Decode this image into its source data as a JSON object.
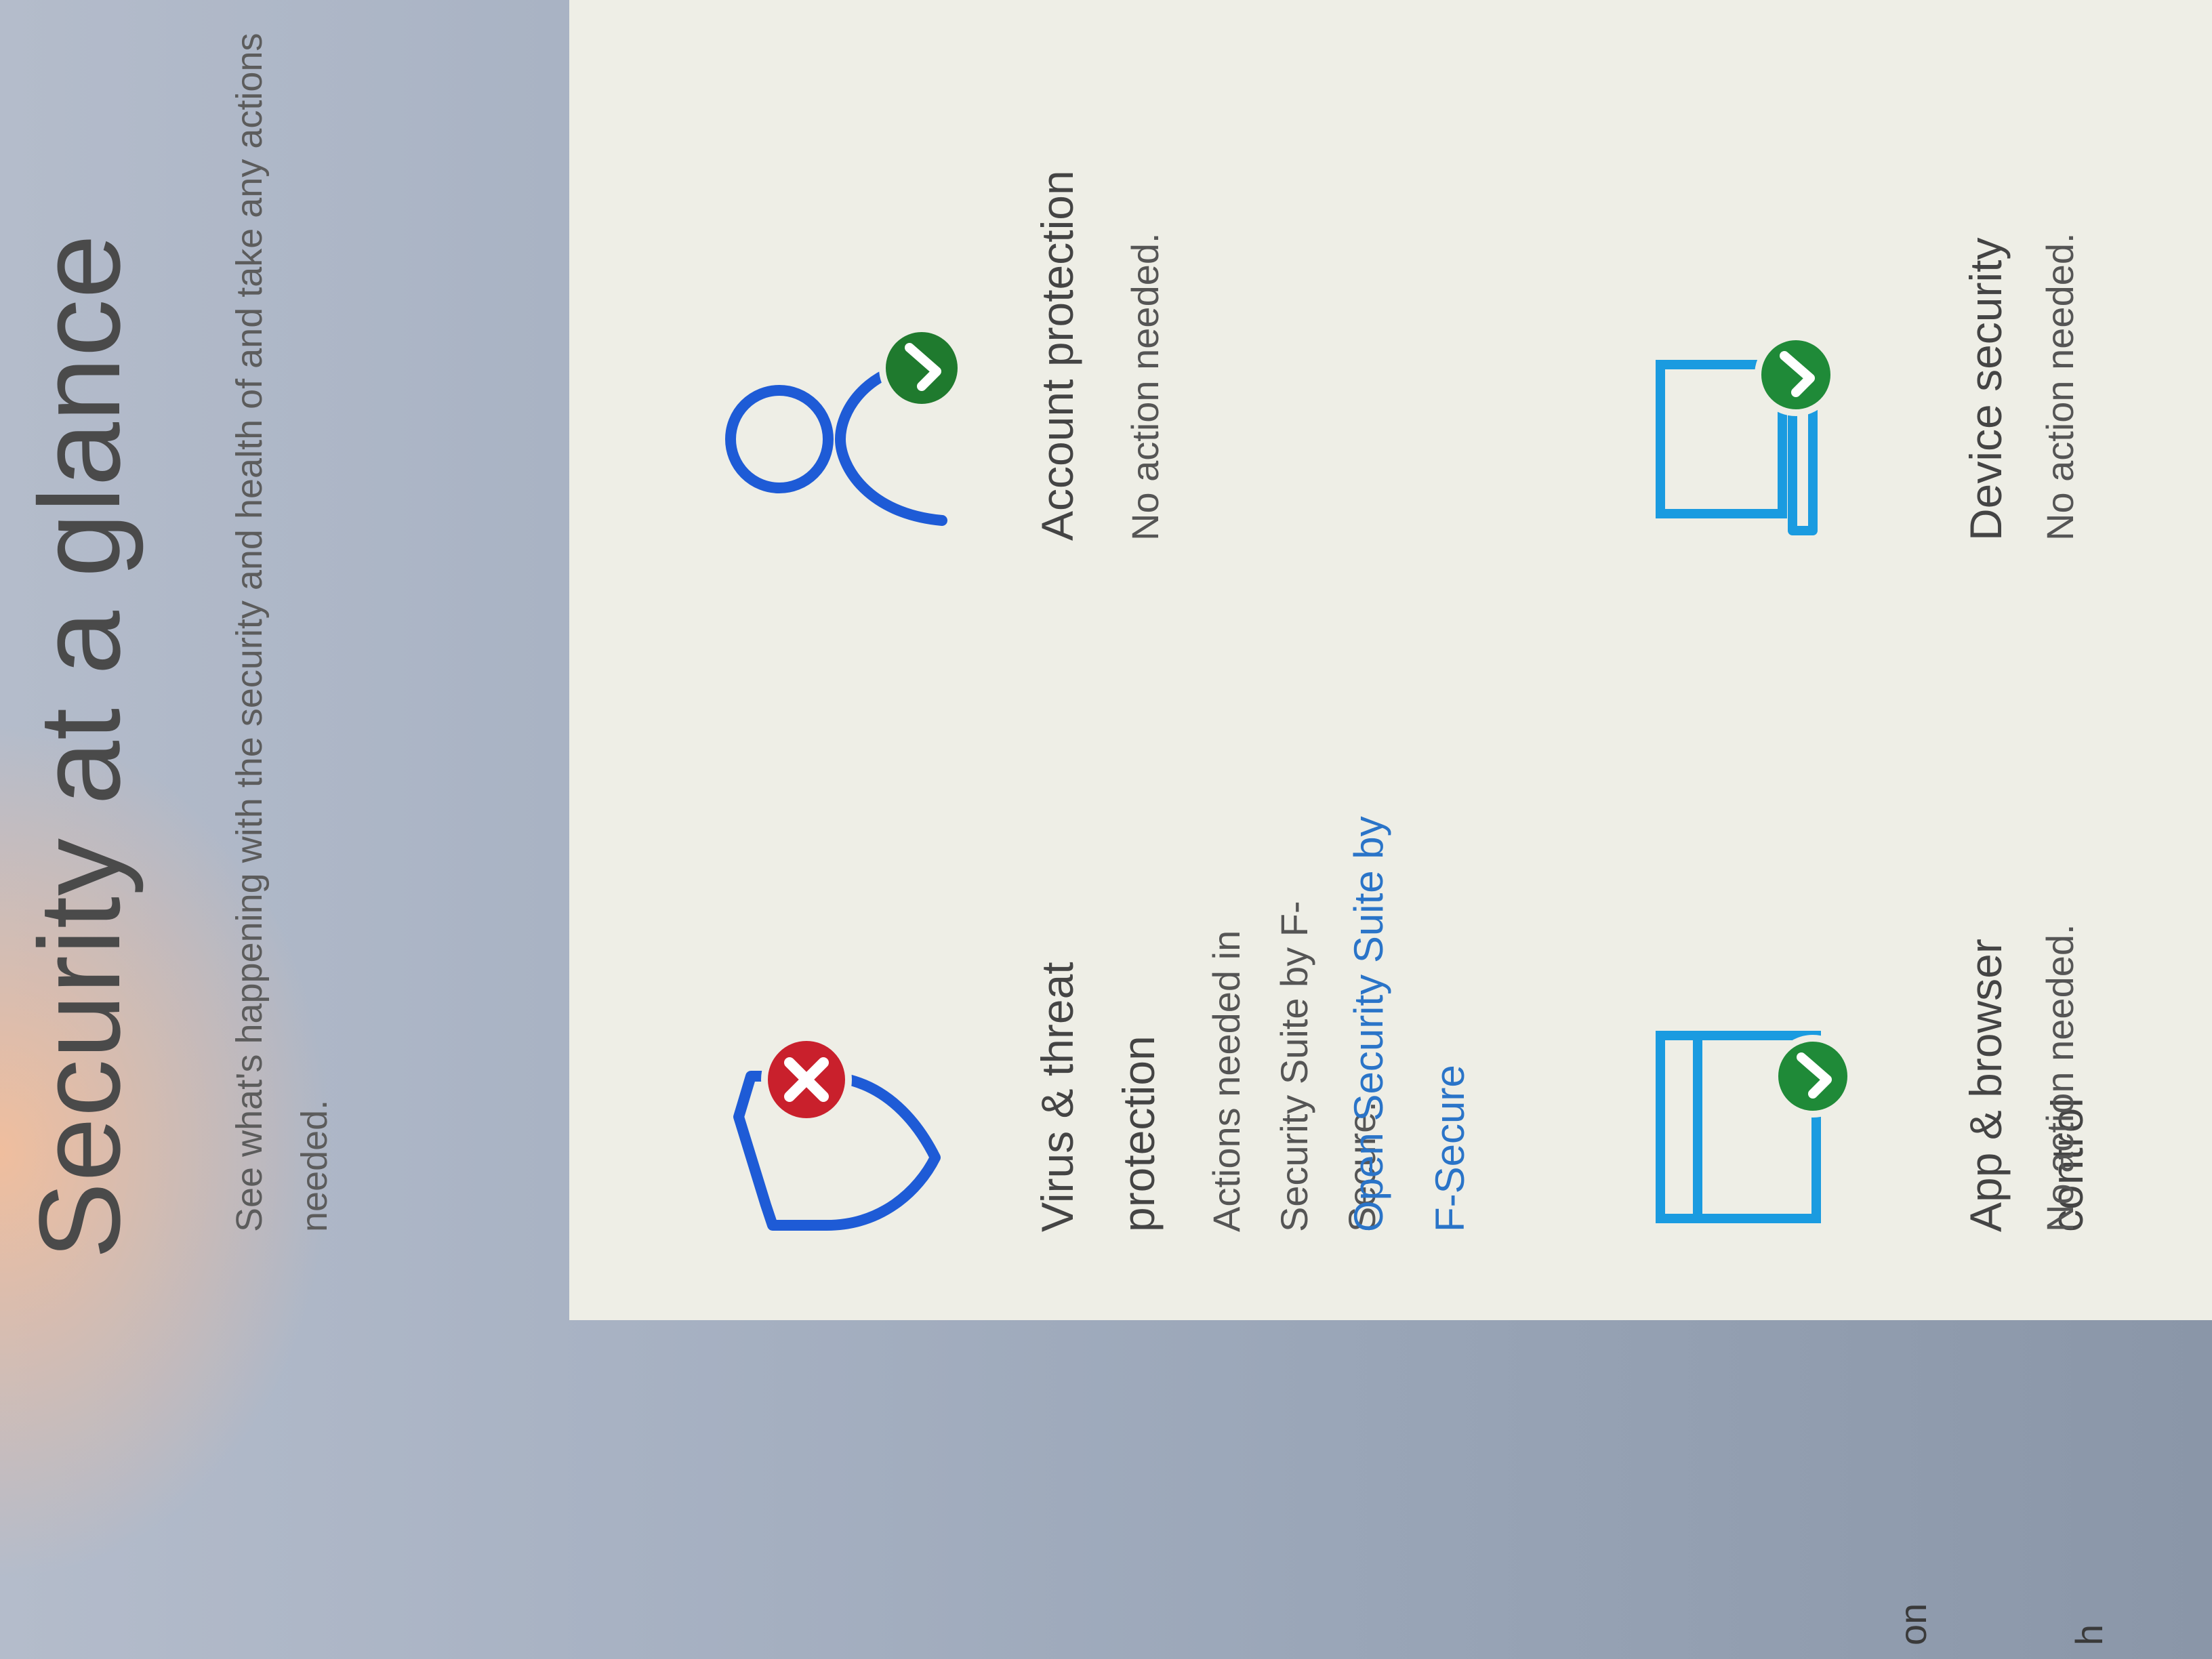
{
  "sidebar": {
    "fragments": [
      "on",
      "h"
    ]
  },
  "header": {
    "title": "Security at a glance",
    "subtitle": "See what's happening with the security and health of and take any actions needed."
  },
  "tiles": [
    {
      "title": "Virus & threat protection",
      "status": "Actions needed in Security Suite by F-Secure.",
      "link": "Open Security Suite by F-Secure",
      "icon": "shield-icon",
      "badge": "error-x-badge-icon",
      "badge_color": "#c9202c"
    },
    {
      "title": "Account protection",
      "status": "No action needed.",
      "icon": "person-icon",
      "badge": "check-badge-icon",
      "badge_color": "#1f7a2e"
    },
    {
      "title": "App & browser control",
      "status": "No action needed.",
      "icon": "browser-window-icon",
      "badge": "check-badge-icon",
      "badge_color": "#1f8a38"
    },
    {
      "title": "Device security",
      "status": "No action needed.",
      "icon": "laptop-icon",
      "badge": "check-badge-icon",
      "badge_color": "#1f8a38"
    }
  ],
  "colors": {
    "accent": "#1e5bd6",
    "link": "#2a74c8",
    "icon_cyan": "#1a9be0",
    "panel_bg": "#eeeee6"
  }
}
